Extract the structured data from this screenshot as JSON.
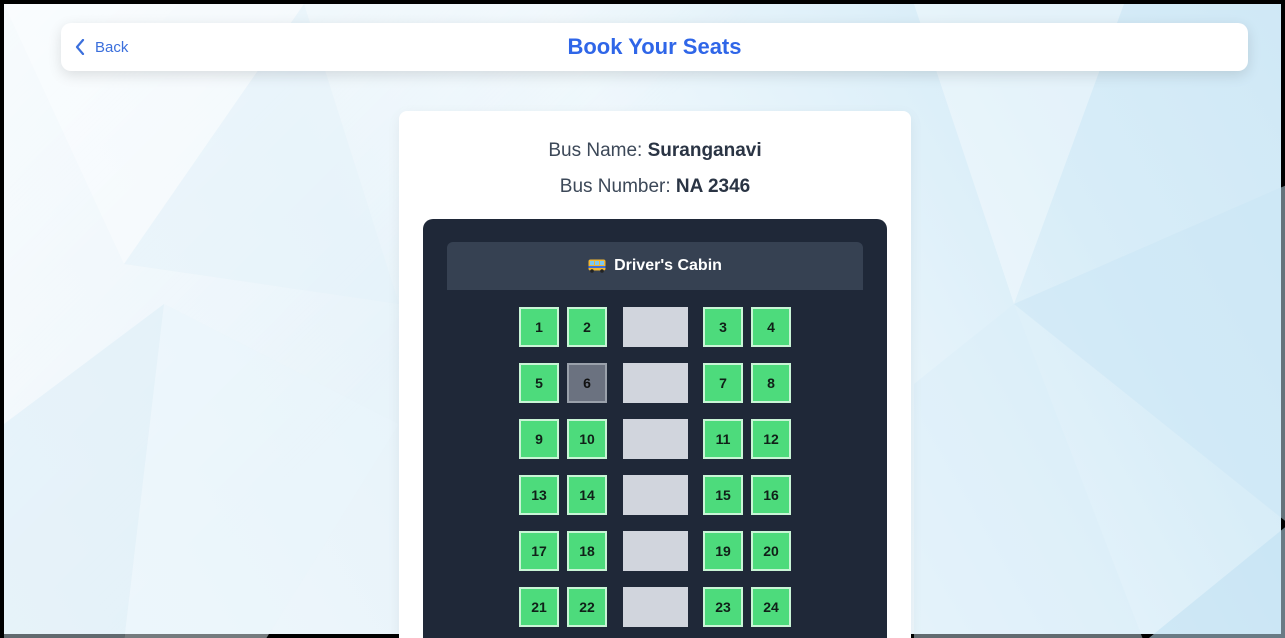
{
  "header": {
    "back_label": "Back",
    "title": "Book Your Seats"
  },
  "bus": {
    "name_label": "Bus Name:",
    "name": "Suranganavi",
    "number_label": "Bus Number:",
    "number": "NA 2346"
  },
  "cabin": {
    "label": "Driver's Cabin",
    "icon": "bus-icon"
  },
  "seats": [
    {
      "label": "1",
      "status": "available"
    },
    {
      "label": "2",
      "status": "available"
    },
    {
      "label": "3",
      "status": "available"
    },
    {
      "label": "4",
      "status": "available"
    },
    {
      "label": "5",
      "status": "available"
    },
    {
      "label": "6",
      "status": "booked"
    },
    {
      "label": "7",
      "status": "available"
    },
    {
      "label": "8",
      "status": "available"
    },
    {
      "label": "9",
      "status": "available"
    },
    {
      "label": "10",
      "status": "available"
    },
    {
      "label": "11",
      "status": "available"
    },
    {
      "label": "12",
      "status": "available"
    },
    {
      "label": "13",
      "status": "available"
    },
    {
      "label": "14",
      "status": "available"
    },
    {
      "label": "15",
      "status": "available"
    },
    {
      "label": "16",
      "status": "available"
    },
    {
      "label": "17",
      "status": "available"
    },
    {
      "label": "18",
      "status": "available"
    },
    {
      "label": "19",
      "status": "available"
    },
    {
      "label": "20",
      "status": "available"
    },
    {
      "label": "21",
      "status": "available"
    },
    {
      "label": "22",
      "status": "available"
    },
    {
      "label": "23",
      "status": "available"
    },
    {
      "label": "24",
      "status": "available"
    }
  ],
  "colors": {
    "accent": "#2f66e8",
    "seat_available": "#4ddb7c",
    "seat_booked": "#6b7280",
    "bus_body": "#1f2838",
    "aisle": "#d1d5dd"
  }
}
